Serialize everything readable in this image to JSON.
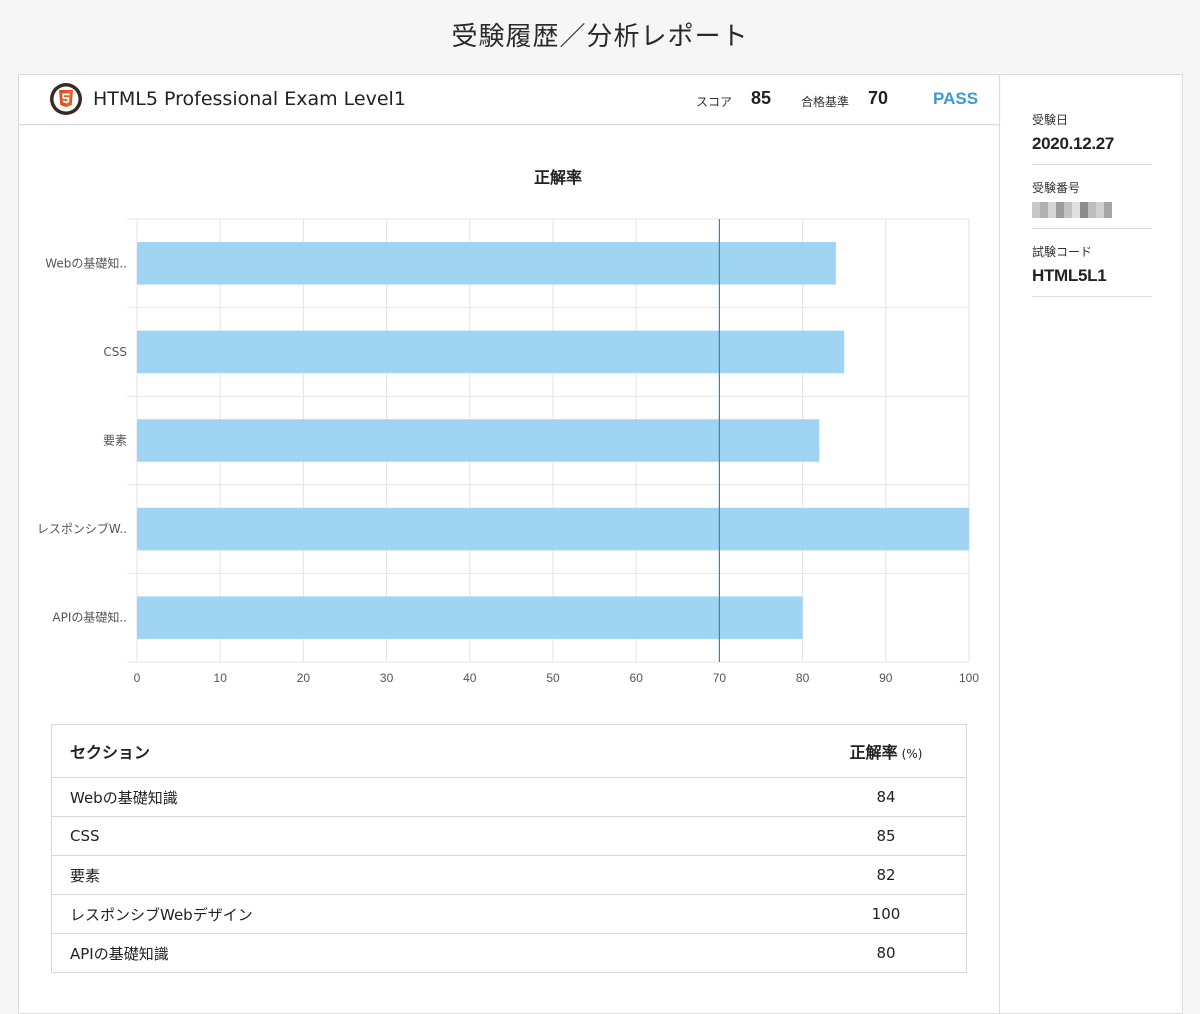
{
  "page_title": "受験履歴／分析レポート",
  "exam": {
    "name": "HTML5 Professional Exam Level1",
    "score_label": "スコア",
    "score": "85",
    "threshold_label": "合格基準",
    "threshold": "70",
    "result": "PASS"
  },
  "sidebar": {
    "date_label": "受験日",
    "date": "2020.12.27",
    "number_label": "受験番号",
    "code_label": "試験コード",
    "code": "HTML5L1"
  },
  "chart_data": {
    "type": "bar",
    "orientation": "horizontal",
    "title": "正解率",
    "categories": [
      "Webの基礎知..",
      "CSS",
      "要素",
      "レスポンシブW..",
      "APIの基礎知.."
    ],
    "values": [
      84,
      85,
      82,
      100,
      80
    ],
    "xlim": [
      0,
      100
    ],
    "xticks": [
      0,
      10,
      20,
      30,
      40,
      50,
      60,
      70,
      80,
      90,
      100
    ],
    "reference_line": 70,
    "bar_color": "#9fd5f3",
    "reference_color": "#2f86c9",
    "grid": true
  },
  "table": {
    "header_section": "セクション",
    "header_rate": "正解率",
    "header_unit": "(%)",
    "rows": [
      {
        "section": "Webの基礎知識",
        "rate": "84"
      },
      {
        "section": "CSS",
        "rate": "85"
      },
      {
        "section": "要素",
        "rate": "82"
      },
      {
        "section": "レスポンシブWebデザイン",
        "rate": "100"
      },
      {
        "section": "APIの基礎知識",
        "rate": "80"
      }
    ]
  },
  "colors": {
    "accent": "#3a9ad9"
  }
}
